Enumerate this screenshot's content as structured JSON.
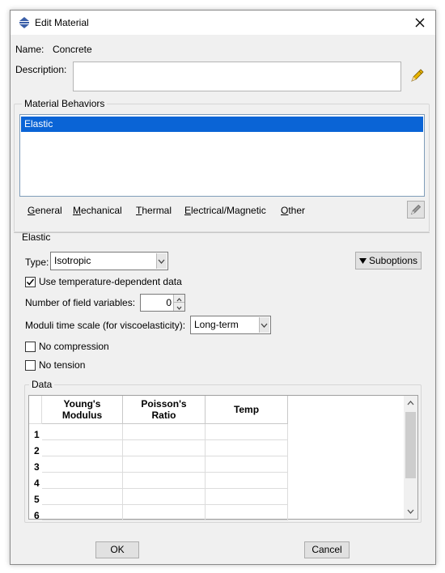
{
  "window": {
    "title": "Edit Material"
  },
  "name": {
    "label": "Name:",
    "value": "Concrete"
  },
  "description": {
    "label": "Description:",
    "value": ""
  },
  "behaviors": {
    "group_title": "Material Behaviors",
    "items": [
      "Elastic"
    ],
    "selected": "Elastic"
  },
  "menu": {
    "items": [
      {
        "first": "G",
        "rest": "eneral"
      },
      {
        "first": "M",
        "rest": "echanical"
      },
      {
        "first": "T",
        "rest": "hermal"
      },
      {
        "first": "E",
        "rest": "lectrical/Magnetic"
      },
      {
        "first": "O",
        "rest": "ther"
      }
    ]
  },
  "elastic": {
    "section_title": "Elastic",
    "type_label": "Type:",
    "type_value": "Isotropic",
    "suboptions_label": "Suboptions",
    "use_temp_label": "Use temperature-dependent data",
    "use_temp_checked": true,
    "field_vars_label": "Number of field variables:",
    "field_vars_value": "0",
    "moduli_label": "Moduli time scale (for viscoelasticity):",
    "moduli_value": "Long-term",
    "no_compression_label": "No compression",
    "no_compression_checked": false,
    "no_tension_label": "No tension",
    "no_tension_checked": false
  },
  "data_table": {
    "group_title": "Data",
    "columns": [
      {
        "line1": "Young's",
        "line2": "Modulus"
      },
      {
        "line1": "Poisson's",
        "line2": "Ratio"
      },
      {
        "line1": "Temp",
        "line2": ""
      }
    ],
    "rows": [
      "1",
      "2",
      "3",
      "4",
      "5",
      "6"
    ]
  },
  "buttons": {
    "ok": "OK",
    "cancel": "Cancel"
  },
  "colors": {
    "selection": "#0a64d6",
    "pencil": "#e8b400"
  },
  "icons": {
    "title": "abaqus-app-icon",
    "close": "close-icon",
    "description_edit": "pencil-icon",
    "menu_edit": "pencil-icon",
    "suboptions": "triangle-down-icon"
  }
}
